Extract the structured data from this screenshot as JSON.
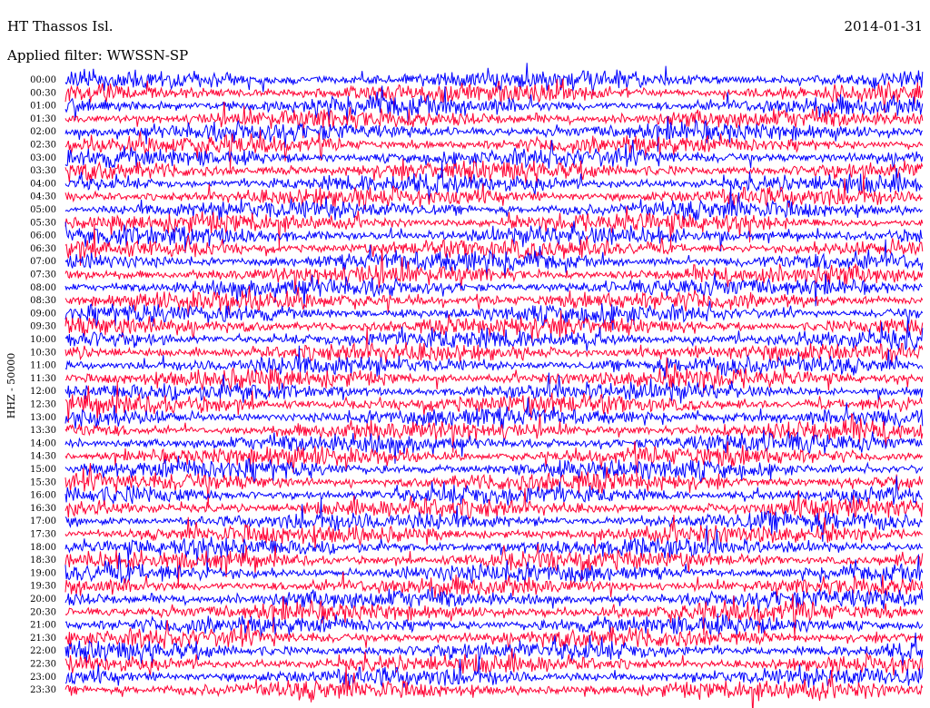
{
  "header": {
    "station": "HT Thassos Isl.",
    "date": "2014-01-31",
    "filter": "Applied filter: WWSSN-SP"
  },
  "chart_data": {
    "type": "line",
    "title": "HT Thassos Isl.",
    "ylabel": "HHZ - 50000",
    "row_labels": [
      "00:00",
      "00:30",
      "01:00",
      "01:30",
      "02:00",
      "02:30",
      "03:00",
      "03:30",
      "04:00",
      "04:30",
      "05:00",
      "05:30",
      "06:00",
      "06:30",
      "07:00",
      "07:30",
      "08:00",
      "08:30",
      "09:00",
      "09:30",
      "10:00",
      "10:30",
      "11:00",
      "11:30",
      "12:00",
      "12:30",
      "13:00",
      "13:30",
      "14:00",
      "14:30",
      "15:00",
      "15:30",
      "16:00",
      "16:30",
      "17:00",
      "17:30",
      "18:00",
      "18:30",
      "19:00",
      "19:30",
      "20:00",
      "20:30",
      "21:00",
      "21:30",
      "22:00",
      "22:30",
      "23:00",
      "23:30"
    ],
    "series_colors": [
      "#0000ff",
      "#ff0033"
    ]
  }
}
